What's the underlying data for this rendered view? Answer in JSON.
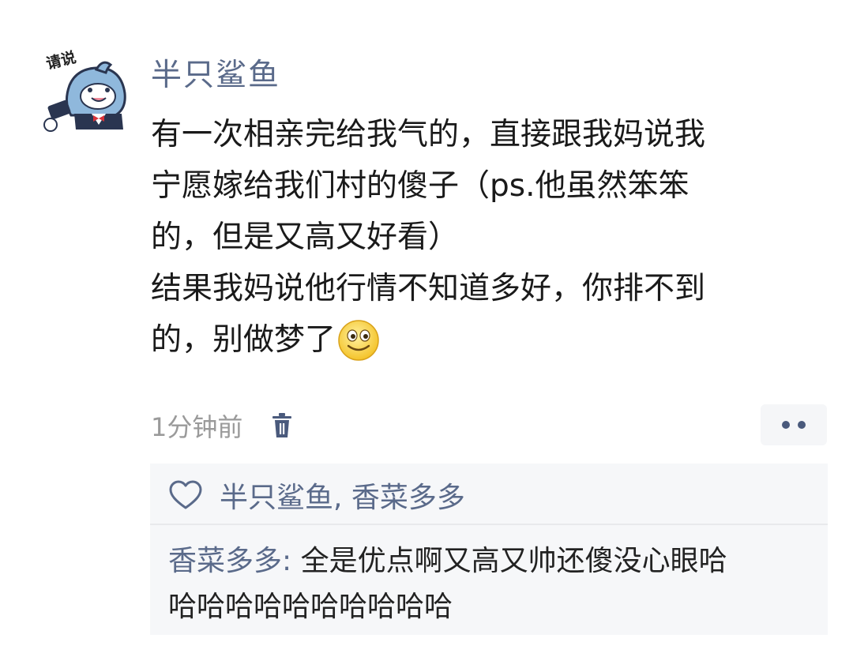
{
  "post": {
    "avatar_label": "请说",
    "username": "半只鲨鱼",
    "lines": [
      "有一次相亲完给我气的，直接跟我妈说我",
      "宁愿嫁给我们村的傻子（ps.他虽然笨笨",
      "的，但是又高又好看）",
      "结果我妈说他行情不知道多好，你排不到",
      "的，别做梦了"
    ],
    "emoji": "smiley-emoji",
    "time": "1分钟前"
  },
  "likes": {
    "icon": "heart-icon",
    "names": "半只鲨鱼, 香菜多多"
  },
  "comment": {
    "author": "香菜多多",
    "separator": ": ",
    "line1": "全是优点啊又高又帅还傻没心眼哈",
    "line2": "哈哈哈哈哈哈哈哈哈哈"
  },
  "colors": {
    "name_blue": "#5a6a8a",
    "text": "#1a1a1a",
    "time_gray": "#9a9a9a",
    "reply_bg": "#f6f7f9"
  }
}
